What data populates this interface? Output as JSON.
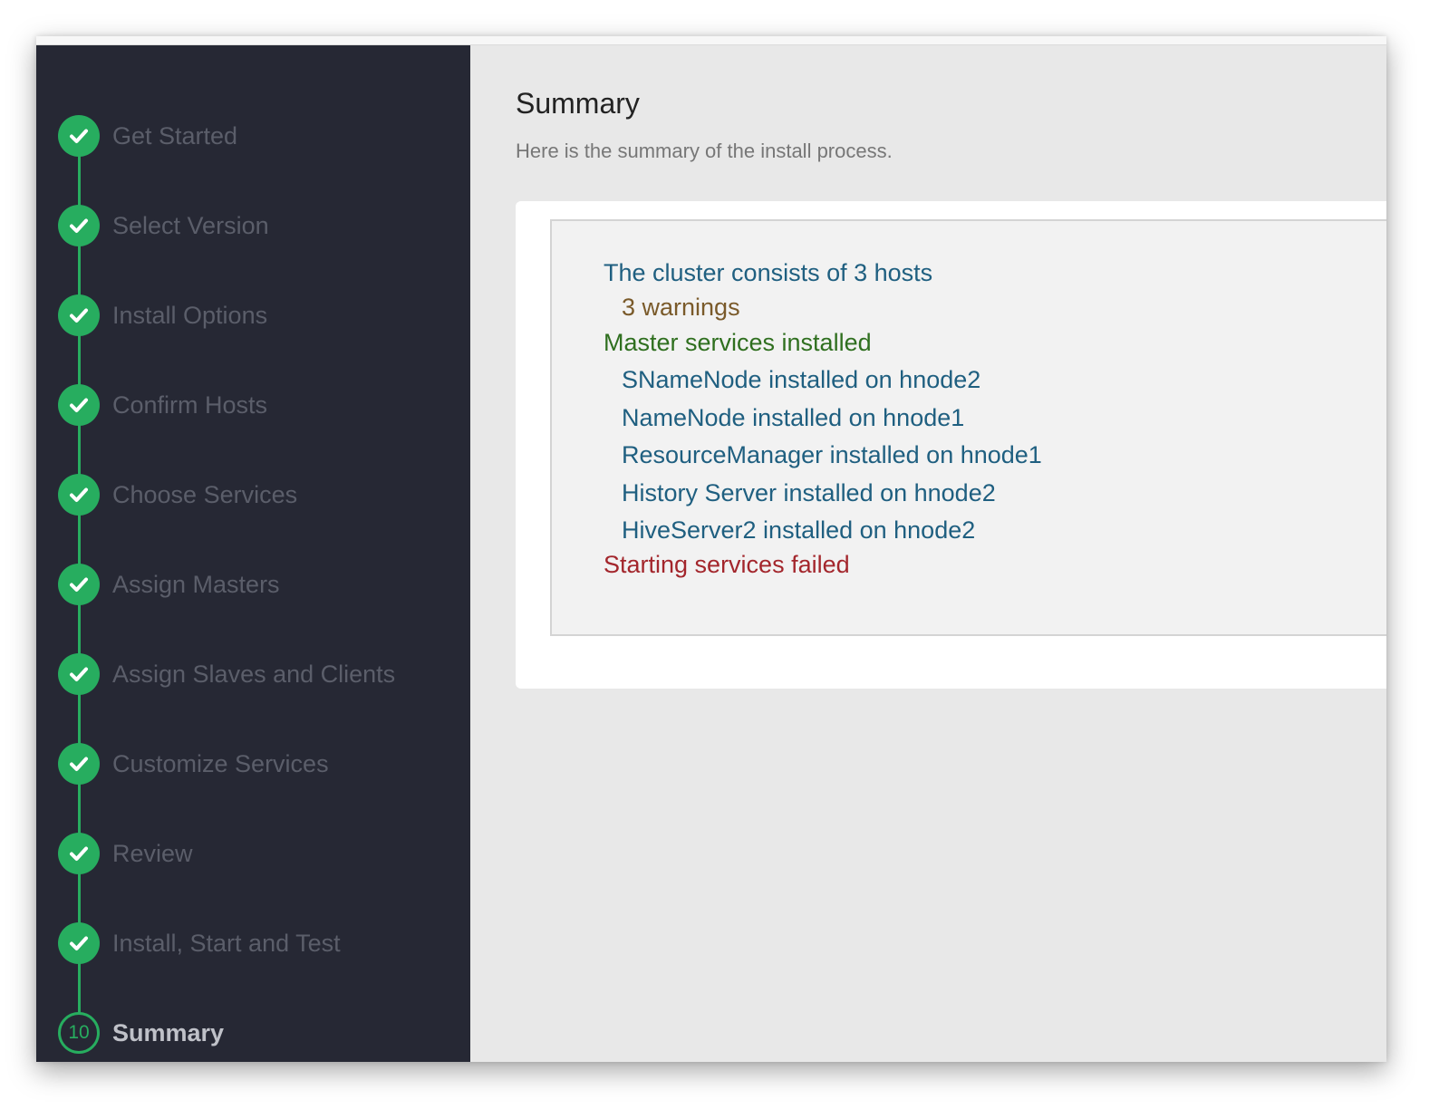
{
  "steps": [
    {
      "label": "Get Started",
      "status": "done"
    },
    {
      "label": "Select Version",
      "status": "done"
    },
    {
      "label": "Install Options",
      "status": "done"
    },
    {
      "label": "Confirm Hosts",
      "status": "done"
    },
    {
      "label": "Choose Services",
      "status": "done"
    },
    {
      "label": "Assign Masters",
      "status": "done"
    },
    {
      "label": "Assign Slaves and Clients",
      "status": "done"
    },
    {
      "label": "Customize Services",
      "status": "done"
    },
    {
      "label": "Review",
      "status": "done"
    },
    {
      "label": "Install, Start and Test",
      "status": "done"
    },
    {
      "label": "Summary",
      "status": "current",
      "number": "10"
    }
  ],
  "main": {
    "title": "Summary",
    "subtitle": "Here is the summary of the install process."
  },
  "summary": {
    "cluster": "The cluster consists of 3 hosts",
    "warnings": "3 warnings",
    "master_services": "Master services installed",
    "services": [
      "SNameNode installed on hnode2",
      "NameNode installed on hnode1",
      "ResourceManager installed on hnode1",
      "History Server installed on hnode2",
      "HiveServer2 installed on hnode2"
    ],
    "start_status": "Starting services failed"
  },
  "colors": {
    "sidebar_bg": "#262834",
    "accent_green": "#27ad5f",
    "info_blue": "#1f5f80",
    "warning_brown": "#7a5a2a",
    "success_green": "#2f6f1f",
    "error_red": "#a3262c"
  },
  "icons": {
    "done": "check-circle-icon"
  }
}
